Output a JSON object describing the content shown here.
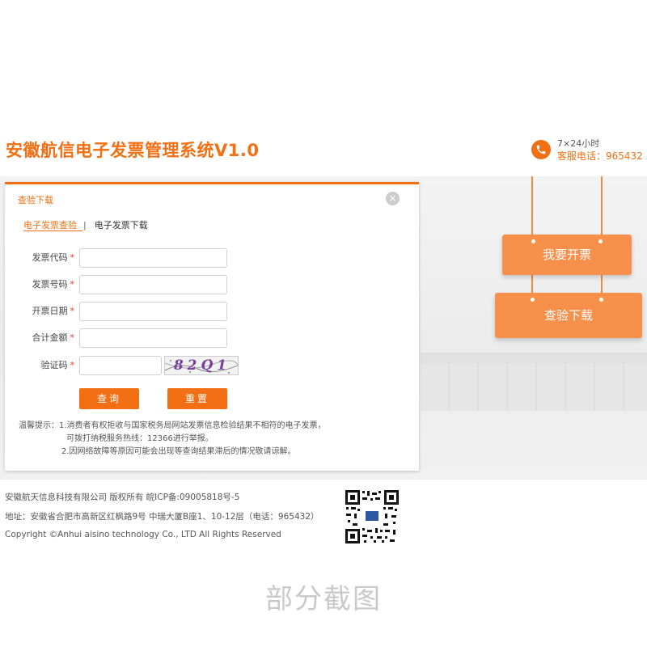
{
  "header": {
    "title": "安徽航信电子发票管理系统V1.0",
    "hotline_line1": "7×24小时",
    "hotline_line2": "客服电话：965432"
  },
  "banner": {
    "sign_open_label": "我要开票",
    "sign_check_label": "查验下载"
  },
  "panel": {
    "title": "查验下载",
    "close_symbol": "×",
    "tabs": [
      {
        "label": "电子发票查验",
        "active": true
      },
      {
        "label": "电子发票下载",
        "active": false
      }
    ],
    "tab_separator": "|",
    "fields": [
      {
        "label": "发票代码",
        "required_mark": "*",
        "value": ""
      },
      {
        "label": "发票号码",
        "required_mark": "*",
        "value": ""
      },
      {
        "label": "开票日期",
        "required_mark": "*",
        "value": ""
      },
      {
        "label": "合计金额",
        "required_mark": "*",
        "value": ""
      },
      {
        "label": "验证码",
        "required_mark": "*",
        "value": ""
      }
    ],
    "captcha_text": "82Q1",
    "query_button": "查询",
    "reset_button": "重置",
    "tips": [
      "温馨提示：1.消费者有权拒收与国家税务局网站发票信息检验结果不相符的电子发票，",
      "可拨打纳税服务热线：12366进行举报。",
      "2.因网络故障等原因可能会出现等查询结果滞后的情况敬请谅解。"
    ]
  },
  "footer": {
    "line1": "安徽航天信息科技有限公司 版权所有 皖ICP备:09005818号-5",
    "line2": "地址：安徽省合肥市高新区红枫路9号 中瑞大厦B座1、10-12层（电话：965432）",
    "line3": "Copyright ©Anhui aisino technology Co., LTD All Rights Reserved"
  },
  "caption": "部分截图",
  "colors": {
    "brand": "#f26f13",
    "sign": "#f7904a",
    "required": "#e33333"
  },
  "icons": [
    "phone-icon",
    "close-icon",
    "qr-code-icon"
  ]
}
